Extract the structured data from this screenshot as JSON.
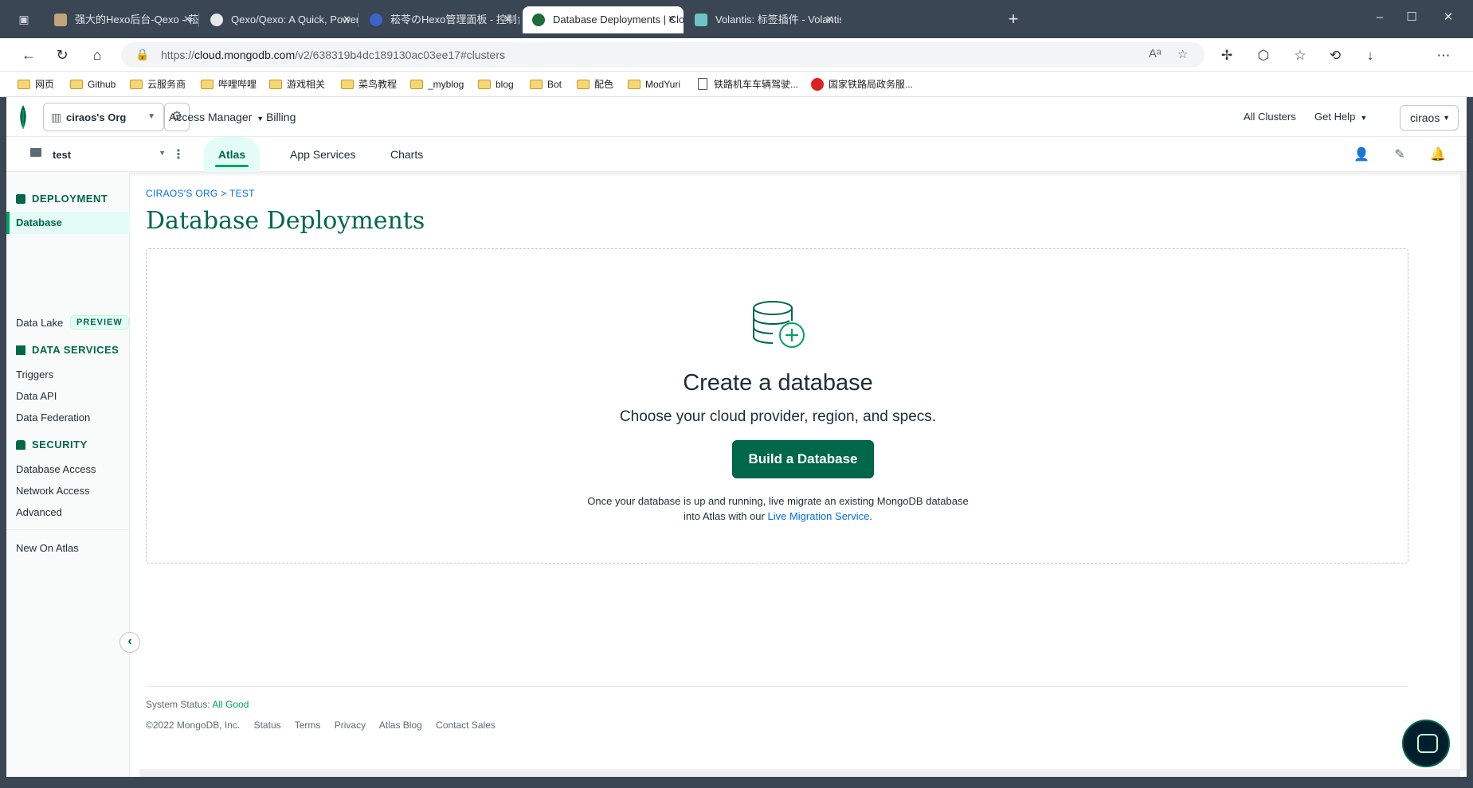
{
  "browser": {
    "tabs": [
      {
        "title": "强大的Hexo后台-Qexo - 菘苓",
        "fav_color": "#c4a37a"
      },
      {
        "title": "Qexo/Qexo: A Quick, Powerful and",
        "fav_color": "#e8e8e8"
      },
      {
        "title": "菘苓のHexo管理面板 - 控制台",
        "fav_color": "#3b63c9"
      },
      {
        "title": "Database Deployments | Cloud: I",
        "fav_color": "#1f6b3b"
      },
      {
        "title": "Volantis: 标签插件 - Volantis",
        "fav_color": "#6cc4c8"
      }
    ],
    "new_tab": "+",
    "window_controls": {
      "minimize": "–",
      "maximize": "☐",
      "close": "✕"
    },
    "url_prefix": "https://",
    "url_domain": "cloud.mongodb.com",
    "url_path": "/v2/638319b4dc189130ac03ee17#clusters",
    "bookmarks": [
      {
        "label": "网页",
        "icon": "folder"
      },
      {
        "label": "Github",
        "icon": "folder"
      },
      {
        "label": "云服务商",
        "icon": "folder"
      },
      {
        "label": "哔哩哔哩",
        "icon": "folder"
      },
      {
        "label": "游戏相关",
        "icon": "folder"
      },
      {
        "label": "菜鸟教程",
        "icon": "folder"
      },
      {
        "label": "_myblog",
        "icon": "folder"
      },
      {
        "label": "blog",
        "icon": "folder"
      },
      {
        "label": "Bot",
        "icon": "folder"
      },
      {
        "label": "配色",
        "icon": "folder"
      },
      {
        "label": "ModYuri",
        "icon": "folder"
      },
      {
        "label": "铁路机车车辆驾驶...",
        "icon": "document"
      },
      {
        "label": "国家铁路局政务服...",
        "icon": "seal"
      }
    ]
  },
  "orgbar": {
    "org_name": "ciraos's Org",
    "access_manager": "Access Manager",
    "billing": "Billing",
    "all_clusters": "All Clusters",
    "get_help": "Get Help",
    "user": "ciraos"
  },
  "projbar": {
    "project": "test",
    "tabs": [
      "Atlas",
      "App Services",
      "Charts"
    ],
    "active_tab": "Atlas"
  },
  "sidebar": {
    "deployment_heading": "DEPLOYMENT",
    "database": "Database",
    "data_lake": "Data Lake",
    "preview_badge": "PREVIEW",
    "data_services_heading": "DATA SERVICES",
    "triggers": "Triggers",
    "data_api": "Data API",
    "data_federation": "Data Federation",
    "security_heading": "SECURITY",
    "database_access": "Database Access",
    "network_access": "Network Access",
    "advanced": "Advanced",
    "new_on_atlas": "New On Atlas"
  },
  "main": {
    "breadcrumb": "CIRAOS'S ORG > TEST",
    "page_title": "Database Deployments",
    "create_title": "Create a database",
    "create_subtitle": "Choose your cloud provider, region, and specs.",
    "build_button": "Build a Database",
    "migrate_text_1": "Once your database is up and running, live migrate an existing MongoDB database",
    "migrate_text_2": "into Atlas with our ",
    "migrate_link": "Live Migration Service",
    "migrate_text_end": "."
  },
  "footer": {
    "status_label": "System Status: ",
    "status_value": "All Good",
    "copyright": "©2022 MongoDB, Inc.",
    "links": [
      "Status",
      "Terms",
      "Privacy",
      "Atlas Blog",
      "Contact Sales"
    ]
  },
  "colors": {
    "brand_green": "#00684a",
    "accent_green": "#00a35c",
    "link_blue": "#016bf8",
    "chrome_dark": "#3a4653"
  }
}
